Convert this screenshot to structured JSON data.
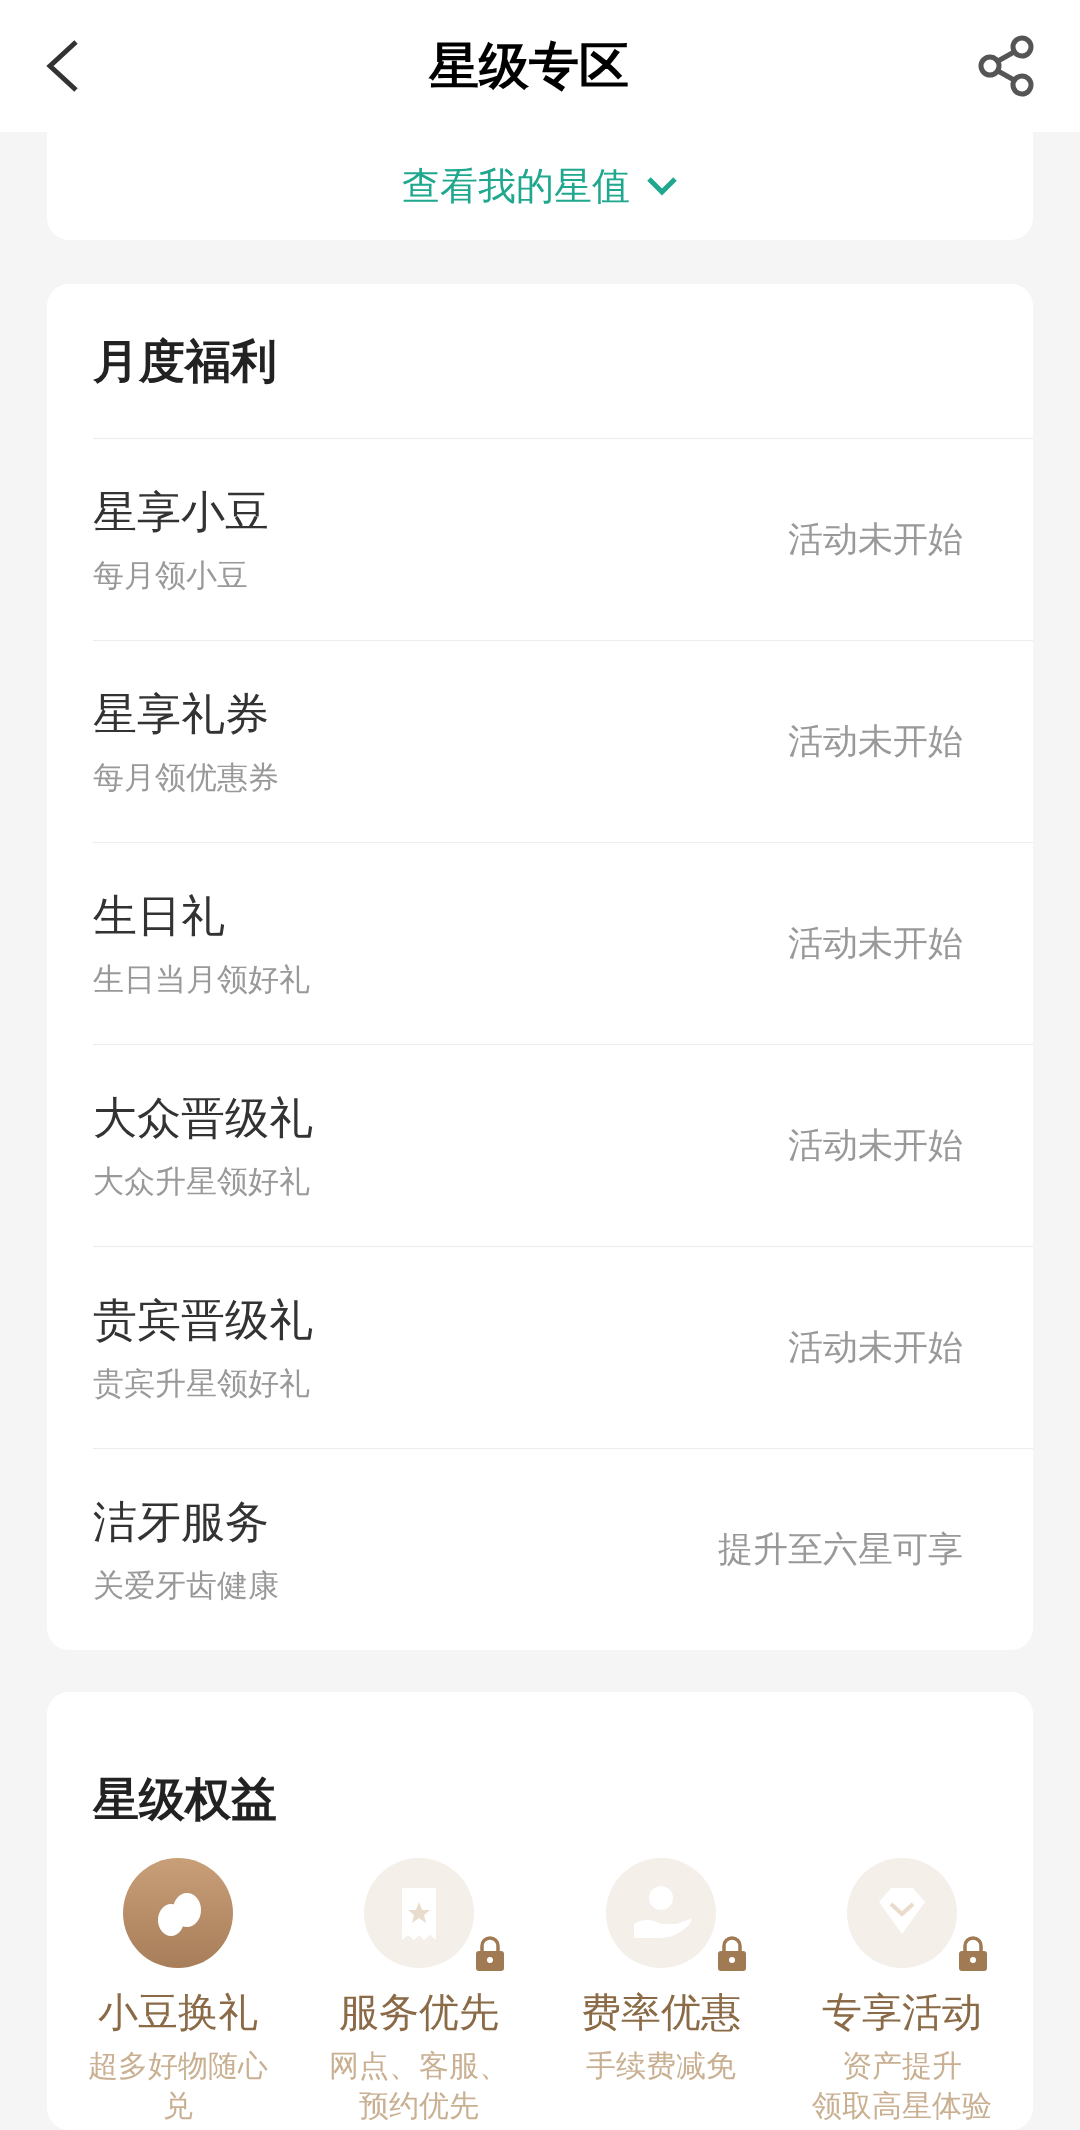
{
  "header": {
    "title": "星级专区"
  },
  "star_value": {
    "label": "查看我的星值",
    "expanded": false
  },
  "monthly": {
    "title": "月度福利",
    "items": [
      {
        "name": "星享小豆",
        "desc": "每月领小豆",
        "status": "活动未开始"
      },
      {
        "name": "星享礼券",
        "desc": "每月领优惠券",
        "status": "活动未开始"
      },
      {
        "name": "生日礼",
        "desc": "生日当月领好礼",
        "status": "活动未开始"
      },
      {
        "name": "大众晋级礼",
        "desc": "大众升星领好礼",
        "status": "活动未开始"
      },
      {
        "name": "贵宾晋级礼",
        "desc": "贵宾升星领好礼",
        "status": "活动未开始"
      },
      {
        "name": "洁牙服务",
        "desc": "关爱牙齿健康",
        "status": "提升至六星可享"
      }
    ]
  },
  "benefits": {
    "title": "星级权益",
    "items": [
      {
        "kind": "beans",
        "label": "小豆换礼",
        "desc_lines": [
          "超多好物随心兑"
        ],
        "locked": false
      },
      {
        "kind": "ticket",
        "label": "服务优先",
        "desc_lines": [
          "网点、客服、预约优先"
        ],
        "locked": true
      },
      {
        "kind": "coin",
        "label": "费率优惠",
        "desc_lines": [
          "手续费减免"
        ],
        "locked": true
      },
      {
        "kind": "diamond",
        "label": "专享活动",
        "desc_lines": [
          "资产提升",
          "领取高星体验"
        ],
        "locked": true
      }
    ]
  }
}
